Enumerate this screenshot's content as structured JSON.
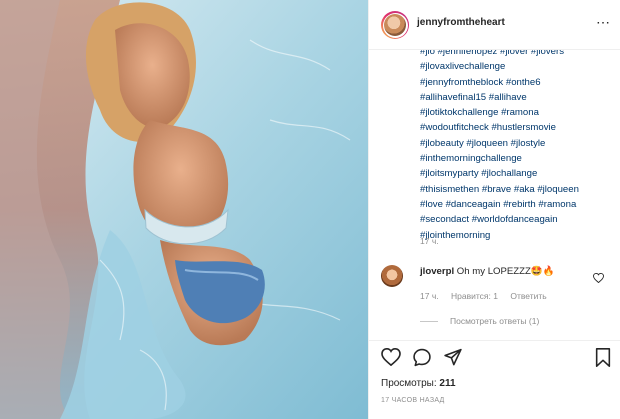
{
  "post": {
    "username": "jennyfromtheheart",
    "more_icon": "⋯",
    "caption_lines": [
      "#jlo #jenniferlopez #jlover #jlovers",
      "#jlovaxlivechallenge",
      "#jennyfromtheblock #onthe6",
      "#allihavefinal15 #allihave",
      "#jlotiktokchallenge #ramona",
      "#wodoutfitcheck #hustlersmovie",
      "#jlobeauty #jloqueen #jlostyle",
      "#inthemorningchallenge",
      "#jloitsmyparty #jlochallange",
      "#thisismethen #brave #aka #jloqueen",
      "#love #danceagain #rebirth #ramona",
      "#secondact #worldofdanceagain",
      "#jlointhemorning"
    ],
    "caption_time": "17 ч."
  },
  "comment": {
    "user": "jloverpl",
    "text": "Oh my LOPEZZZ🤩🔥",
    "time": "17 ч.",
    "likes": "Нравится: 1",
    "reply": "Ответить",
    "view_replies": "Посмотреть ответы (1)"
  },
  "footer": {
    "views_label": "Просмотры:",
    "views_count": "211",
    "posted_ago": "17 ЧАСОВ НАЗАД"
  },
  "icons": {
    "like": "heart-icon",
    "comment": "comment-icon",
    "share": "send-icon",
    "save": "bookmark-icon"
  }
}
